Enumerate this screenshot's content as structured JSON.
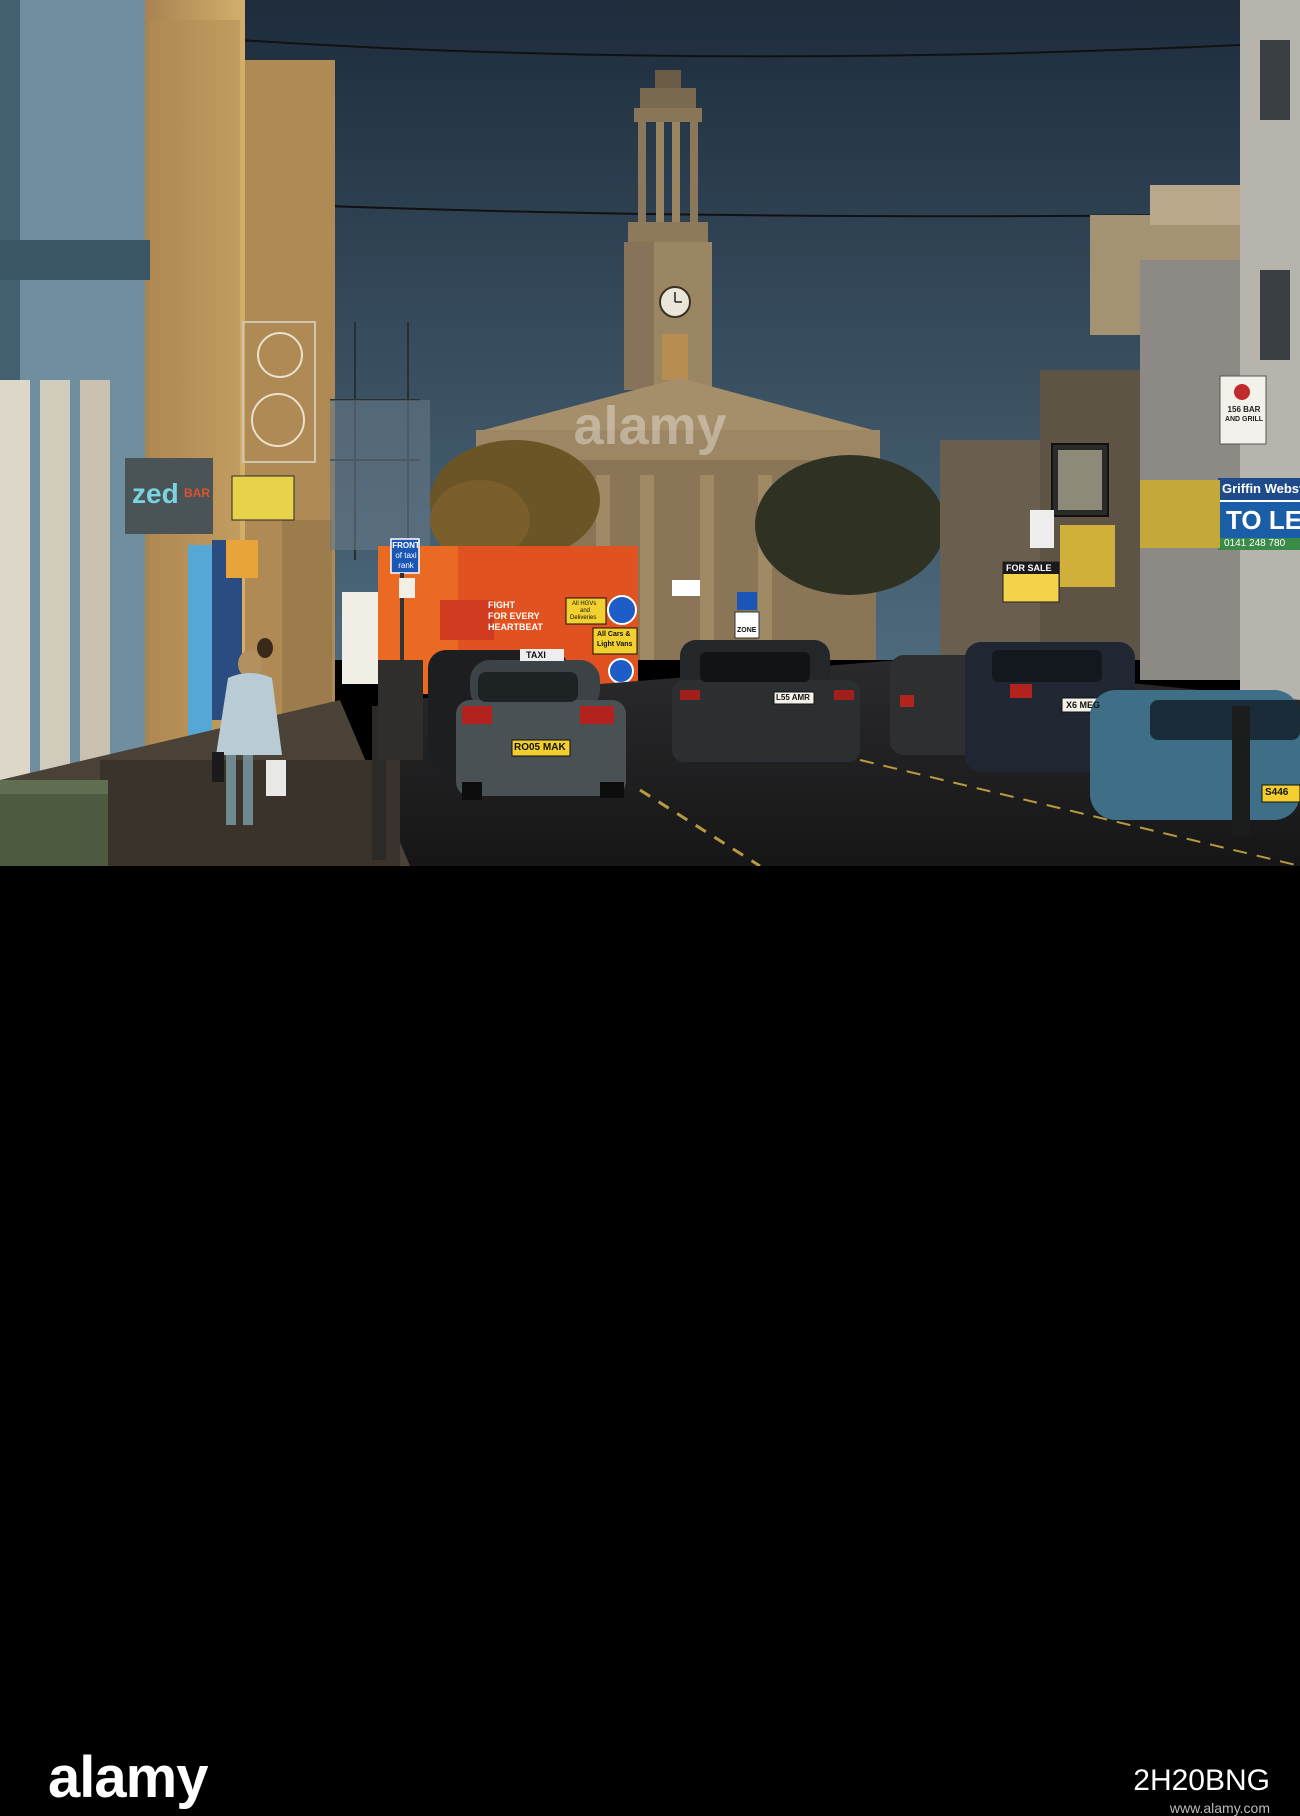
{
  "signs": {
    "zed": "zed",
    "zed_bar": "BAR",
    "front_taxi_1": "FRONT",
    "front_taxi_2": "of taxi",
    "front_taxi_3": "rank",
    "fight_1": "FIGHT",
    "fight_2": "FOR EVERY",
    "fight_3": "HEARTBEAT",
    "hgv_1": "All HGVs",
    "hgv_2": "and",
    "hgv_3": "Deliveries",
    "cars_1": "All Cars &",
    "cars_2": "Light Vans",
    "for_sale": "FOR SALE",
    "to_let": "TO LE",
    "griffin": "Griffin Webst",
    "phone": "0141 248 780",
    "bar_1": "156 BAR",
    "bar_2": "AND GRILL",
    "zone": "ZONE",
    "taxi": "TAXI"
  },
  "plates": {
    "taxi_rear": "RO05 MAK",
    "suv_center": "L55 AMR",
    "ford_right": "X6 MEG",
    "bmw": "S446"
  },
  "watermark": {
    "brand": "alamy",
    "image_id": "2H20BNG",
    "url": "www.alamy.com"
  },
  "colors": {
    "sky_top": "#1e2c3c",
    "sky_bottom": "#4a6578",
    "stone_lit": "#c9a467",
    "stone_shadow": "#6b5a44",
    "barrier": "#e0521f"
  }
}
